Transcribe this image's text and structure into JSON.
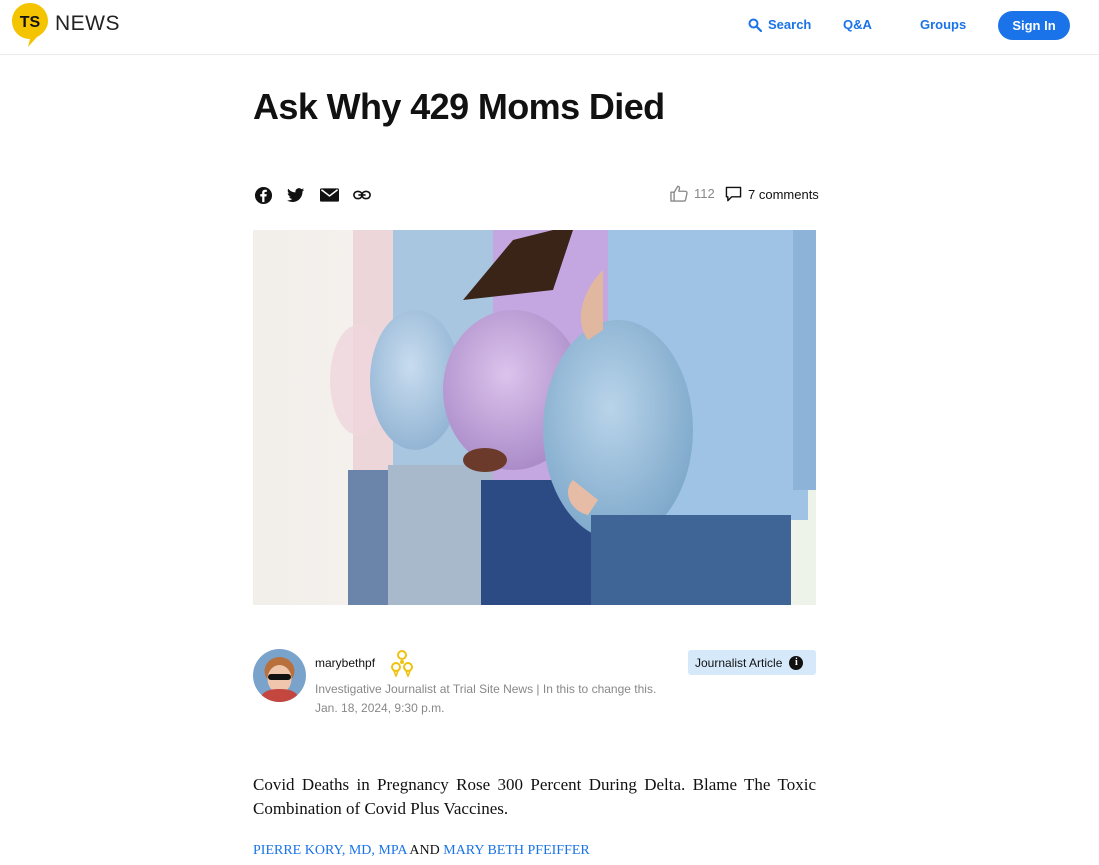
{
  "brand": {
    "logo_mark": "TS",
    "name": "NEWS",
    "colors": {
      "yellow": "#f5c400",
      "blue": "#1a73e8"
    }
  },
  "nav": {
    "search_label": "Search",
    "qa_label": "Q&A",
    "groups_label": "Groups",
    "signin_label": "Sign In"
  },
  "article": {
    "title": "Ask Why 429 Moms Died",
    "share_icons": [
      "facebook-icon",
      "twitter-icon",
      "email-icon",
      "link-icon"
    ],
    "likes": "112",
    "comments": "7 comments",
    "hero_image_alt": "Four pregnant women standing in a row"
  },
  "author": {
    "name": "marybethpf",
    "bio": "Investigative Journalist at Trial Site News | In this to change this.",
    "date": "Jan. 18, 2024, 9:30 p.m.",
    "tag_label": "Journalist Article",
    "tag_info": "i"
  },
  "body": {
    "lead": "Covid Deaths in Pregnancy Rose 300 Percent During Delta. Blame The Toxic Combination of Covid Plus Vaccines.",
    "byline_author1": "PIERRE KORY, MD, MPA",
    "byline_and": "AND",
    "byline_author2": "MARY BETH PFEIFFER"
  }
}
